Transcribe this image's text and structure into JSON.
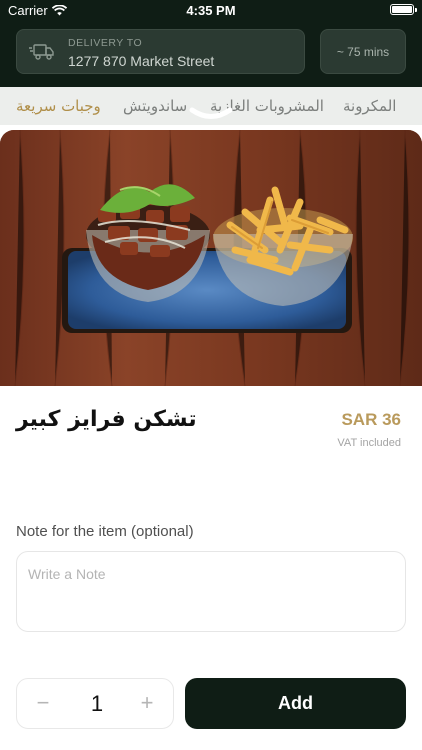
{
  "status_bar": {
    "carrier": "Carrier",
    "time": "4:35 PM"
  },
  "header": {
    "delivery_label": "DELIVERY TO",
    "address": "1277 870 Market Street",
    "eta": "~ 75 mins"
  },
  "categories": {
    "items": [
      "وجبات سريعة",
      "ساندويتش",
      "المشروبات الغازية",
      "المكرونة"
    ],
    "active_color": "#b08f4a"
  },
  "product": {
    "name": "تشكن فرايز كبير",
    "price": "SAR 36",
    "vat": "VAT included",
    "image_icon": "chicken-fries-photo"
  },
  "note": {
    "label": "Note for the item (optional)",
    "placeholder": "Write a Note"
  },
  "quantity": {
    "minus": "−",
    "value": "1",
    "plus": "+"
  },
  "actions": {
    "add_label": "Add"
  },
  "colors": {
    "dark": "#0f1d15",
    "gold": "#b99a5c"
  }
}
